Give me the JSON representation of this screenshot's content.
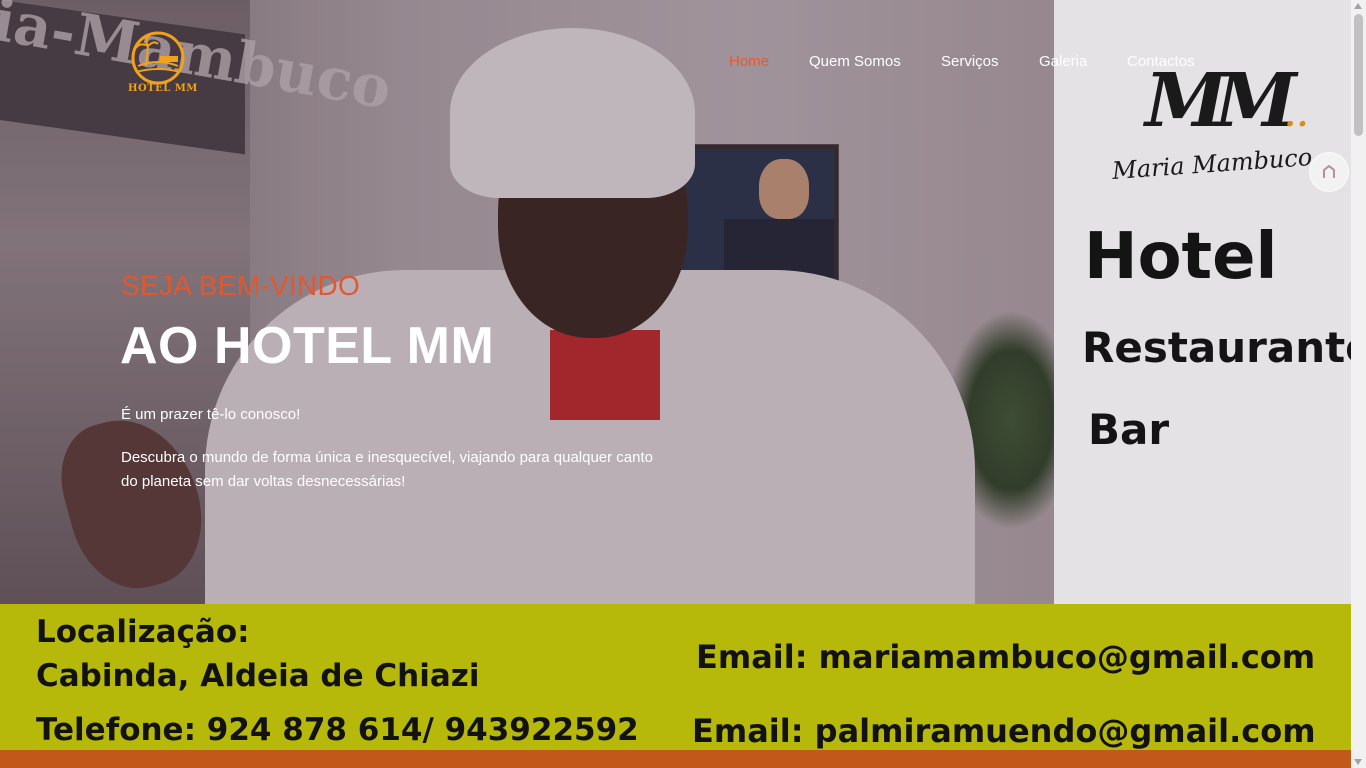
{
  "brand": {
    "logo_text": "HOTEL MM",
    "color": "#f0a21a"
  },
  "nav": {
    "items": [
      {
        "label": "Home",
        "active": true
      },
      {
        "label": "Quem Somos",
        "active": false
      },
      {
        "label": "Serviços",
        "active": false
      },
      {
        "label": "Galeria",
        "active": false
      },
      {
        "label": "Contactos",
        "active": false
      }
    ],
    "active_color": "#e8582e"
  },
  "hero": {
    "kicker": "SEJA BEM-VINDO",
    "title": "AO HOTEL MM",
    "lead": "É um prazer tê-lo conosco!",
    "description": "Descubra o mundo de forma única e inesquecível, viajando para qualquer canto do planeta sem dar voltas desnecessárias!",
    "accent_color": "#e4572e"
  },
  "sign": {
    "script_text": "Maria Mambuco",
    "hotel": "Hotel",
    "restaurant": "Restaurante",
    "bar": "Bar"
  },
  "banner": {
    "location_label": "Localização:",
    "location_value": "Cabinda, Aldeia de Chiazi",
    "phone": "Telefone: 924 878 614/ 943922592",
    "email1": "Email: mariamambuco@gmail.com",
    "email2": "Email: palmiramuendo@gmail.com",
    "background_color": "#b7b90a",
    "strip_color": "#c2581a"
  }
}
